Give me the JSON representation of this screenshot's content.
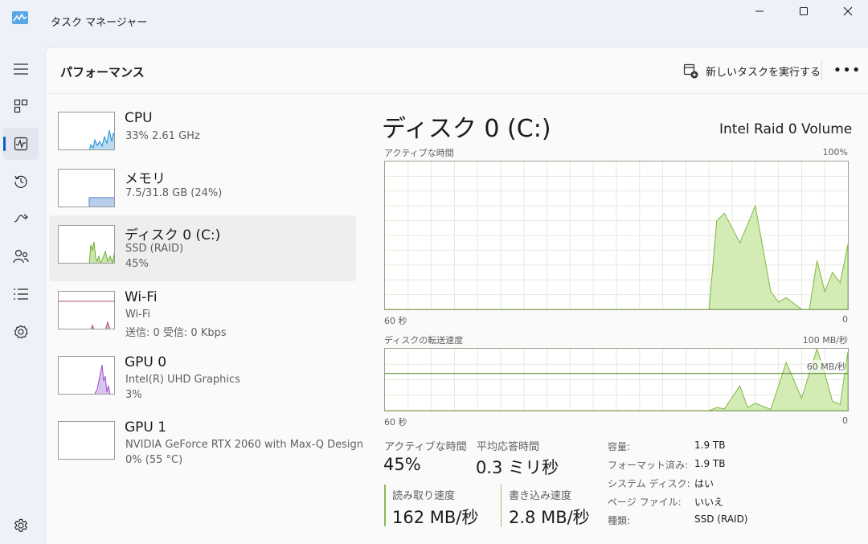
{
  "window": {
    "title": "タスク マネージャー"
  },
  "nav": {
    "items": [
      {
        "name": "menu",
        "icon": "hamburger-icon"
      },
      {
        "name": "processes",
        "icon": "processes-icon"
      },
      {
        "name": "performance",
        "icon": "performance-icon",
        "active": true
      },
      {
        "name": "app-history",
        "icon": "history-icon"
      },
      {
        "name": "startup-apps",
        "icon": "startup-icon"
      },
      {
        "name": "users",
        "icon": "users-icon"
      },
      {
        "name": "details",
        "icon": "details-icon"
      },
      {
        "name": "services",
        "icon": "services-icon"
      },
      {
        "name": "settings",
        "icon": "gear-icon"
      }
    ]
  },
  "header": {
    "title": "パフォーマンス",
    "run_task_label": "新しいタスクを実行する",
    "more_label": "•••"
  },
  "devices": [
    {
      "name": "CPU",
      "line1": "33%  2.61 GHz",
      "line2": "",
      "color": "#1e8fd6"
    },
    {
      "name": "メモリ",
      "line1": "7.5/31.8 GB (24%)",
      "line2": "",
      "color": "#4a7fd0"
    },
    {
      "name": "ディスク 0 (C:)",
      "line1": "SSD (RAID)",
      "line2": "45%",
      "color": "#6aab2a",
      "selected": true
    },
    {
      "name": "Wi-Fi",
      "line1": "Wi-Fi",
      "line2": "送信: 0 受信: 0 Kbps",
      "color": "#b0485e"
    },
    {
      "name": "GPU 0",
      "line1": "Intel(R) UHD Graphics",
      "line2": "3%",
      "color": "#9a4fd0"
    },
    {
      "name": "GPU 1",
      "line1": "NVIDIA GeForce RTX 2060 with Max-Q Design",
      "line2": "0% (55 °C)",
      "color": "#9a4fd0"
    }
  ],
  "detail": {
    "title": "ディスク 0 (C:)",
    "model": "Intel Raid 0 Volume",
    "active_chart": {
      "label": "アクティブな時間",
      "max_label": "100%",
      "x_left": "60 秒",
      "x_right": "0"
    },
    "transfer_chart": {
      "label": "ディスクの転送速度",
      "max_label": "100 MB/秒",
      "ref_label": "60 MB/秒",
      "x_left": "60 秒",
      "x_right": "0"
    },
    "stats": {
      "active_label": "アクティブな時間",
      "active_value": "45%",
      "response_label": "平均応答時間",
      "response_value": "0.3 ミリ秒",
      "read_label": "読み取り速度",
      "read_value": "162 MB/秒",
      "write_label": "書き込み速度",
      "write_value": "2.8 MB/秒"
    },
    "properties": [
      {
        "key": "容量:",
        "value": "1.9 TB"
      },
      {
        "key": "フォーマット済み:",
        "value": "1.9 TB"
      },
      {
        "key": "システム ディスク:",
        "value": "はい"
      },
      {
        "key": "ページ ファイル:",
        "value": "いいえ"
      },
      {
        "key": "種類:",
        "value": "SSD (RAID)"
      }
    ]
  },
  "chart_data": [
    {
      "type": "area",
      "title": "アクティブな時間",
      "ylabel": "",
      "xlabel": "",
      "x_range_label": [
        "60 秒",
        "0"
      ],
      "ylim": [
        0,
        100
      ],
      "x": [
        60,
        54,
        48,
        42,
        36,
        30,
        24,
        18,
        17,
        16,
        14,
        12,
        10,
        9,
        8,
        6,
        5,
        4,
        3,
        2,
        1,
        0
      ],
      "values": [
        0,
        0,
        0,
        0,
        0,
        0,
        0,
        0,
        60,
        65,
        45,
        70,
        12,
        5,
        8,
        0,
        0,
        33,
        12,
        25,
        18,
        44
      ],
      "color": "#8cc850"
    },
    {
      "type": "area",
      "title": "ディスクの転送速度",
      "ylabel": "",
      "xlabel": "",
      "ylim": [
        0,
        100
      ],
      "reference_line": 60,
      "x": [
        60,
        54,
        48,
        42,
        36,
        30,
        24,
        18,
        17,
        16,
        14,
        13,
        12,
        10,
        8,
        6,
        4,
        3,
        2,
        1,
        0
      ],
      "values": [
        0,
        0,
        0,
        0,
        0,
        0,
        0,
        0,
        5,
        3,
        40,
        5,
        12,
        2,
        78,
        20,
        100,
        60,
        15,
        10,
        95
      ],
      "color": "#8cc850"
    }
  ]
}
